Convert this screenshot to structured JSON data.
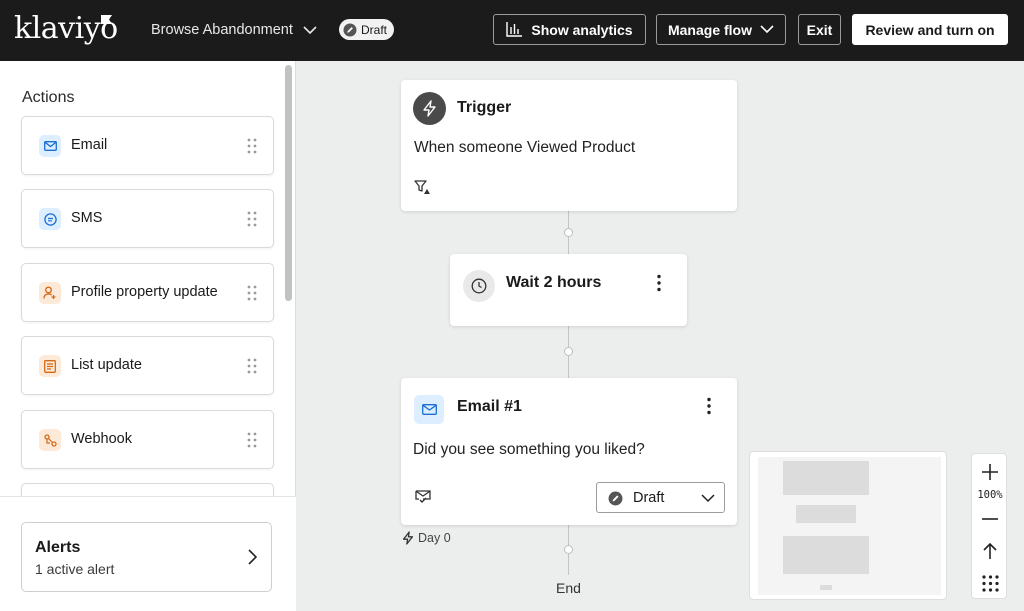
{
  "header": {
    "logo_text": "klaviyo",
    "flow_name": "Browse Abandonment",
    "status_badge": "Draft",
    "show_analytics_label": "Show analytics",
    "manage_flow_label": "Manage flow",
    "exit_label": "Exit",
    "review_label": "Review and turn on"
  },
  "sidebar": {
    "title": "Actions",
    "actions": [
      {
        "label": "Email",
        "icon": "mail-icon"
      },
      {
        "label": "SMS",
        "icon": "sms-icon"
      },
      {
        "label": "Profile property update",
        "icon": "profile-update-icon"
      },
      {
        "label": "List update",
        "icon": "list-update-icon"
      },
      {
        "label": "Webhook",
        "icon": "webhook-icon"
      }
    ],
    "alerts": {
      "title": "Alerts",
      "subtitle": "1 active alert"
    }
  },
  "flow": {
    "trigger": {
      "title": "Trigger",
      "description": "When someone Viewed Product"
    },
    "wait": {
      "title": "Wait 2 hours"
    },
    "email": {
      "title": "Email #1",
      "description": "Did you see something you liked?",
      "status": "Draft"
    },
    "day_label": "Day 0",
    "end_label": "End"
  },
  "zoom": {
    "level": "100%"
  },
  "colors": {
    "topbar": "#1b1b1b",
    "canvas": "#eceded",
    "email_icon_bg": "#dceeff",
    "sms_icon_bg": "#dceeff",
    "profile_icon_bg": "#fde9d8",
    "webhook_icon_bg": "#fde9d8"
  }
}
